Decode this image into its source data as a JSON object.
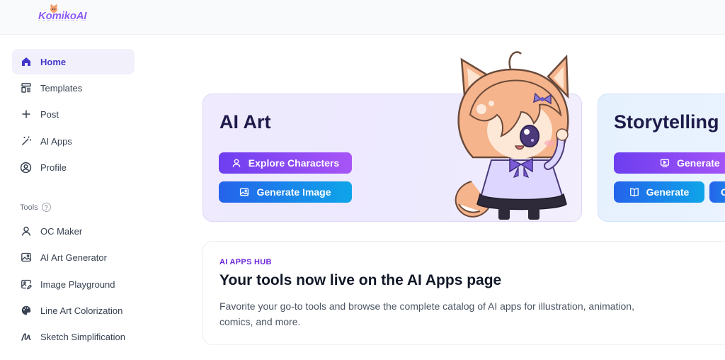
{
  "app": {
    "logo_text": "KomikoAI"
  },
  "sidebar": {
    "items": [
      {
        "label": "Home",
        "icon": "home-icon",
        "active": true
      },
      {
        "label": "Templates",
        "icon": "templates-icon"
      },
      {
        "label": "Post",
        "icon": "plus-icon"
      },
      {
        "label": "AI Apps",
        "icon": "magic-wand-icon"
      },
      {
        "label": "Profile",
        "icon": "user-circle-icon"
      }
    ],
    "tools_label": "Tools",
    "tools_help": "?",
    "tools": [
      {
        "label": "OC Maker",
        "icon": "user-icon"
      },
      {
        "label": "AI Art Generator",
        "icon": "image-icon"
      },
      {
        "label": "Image Playground",
        "icon": "image-edit-icon"
      },
      {
        "label": "Line Art Colorization",
        "icon": "palette-icon"
      },
      {
        "label": "Sketch Simplification",
        "icon": "sketch-icon"
      }
    ]
  },
  "cards": {
    "art": {
      "title": "AI Art",
      "explore_label": "Explore Characters",
      "generate_label": "Generate Image"
    },
    "story": {
      "title": "Storytelling",
      "generate_top_label": "Generate",
      "generate_label": "Generate"
    }
  },
  "hub": {
    "kicker": "AI APPS HUB",
    "title": "Your tools now live on the AI Apps page",
    "description": "Favorite your go-to tools and browse the complete catalog of AI apps for illustration, animation, comics, and more."
  },
  "colors": {
    "accent_purple": "#6d3ef0",
    "accent_blue": "#2563eb",
    "active_nav_bg": "#f1f0fb"
  }
}
